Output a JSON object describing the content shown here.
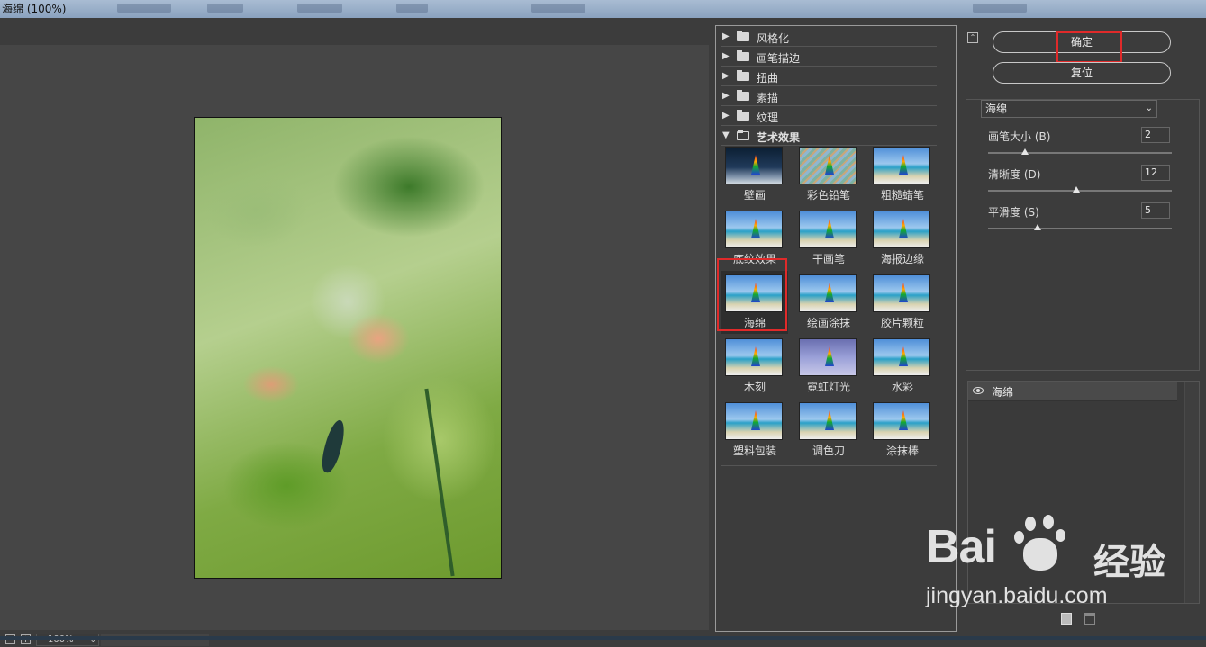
{
  "window": {
    "title": "海绵 (100%)"
  },
  "preview": {
    "zoom_value": "100%"
  },
  "filter_gallery": {
    "categories": [
      {
        "label": "风格化",
        "expanded": false
      },
      {
        "label": "画笔描边",
        "expanded": false
      },
      {
        "label": "扭曲",
        "expanded": false
      },
      {
        "label": "素描",
        "expanded": false
      },
      {
        "label": "纹理",
        "expanded": false
      },
      {
        "label": "艺术效果",
        "expanded": true
      }
    ],
    "thumbnails": [
      {
        "label": "壁画"
      },
      {
        "label": "彩色铅笔"
      },
      {
        "label": "粗糙蜡笔"
      },
      {
        "label": "底纹效果"
      },
      {
        "label": "干画笔"
      },
      {
        "label": "海报边缘"
      },
      {
        "label": "海绵",
        "selected": true
      },
      {
        "label": "绘画涂抹"
      },
      {
        "label": "胶片颗粒"
      },
      {
        "label": "木刻"
      },
      {
        "label": "霓虹灯光"
      },
      {
        "label": "水彩"
      },
      {
        "label": "塑料包装"
      },
      {
        "label": "调色刀"
      },
      {
        "label": "涂抹棒"
      }
    ]
  },
  "actions": {
    "ok_label": "确定",
    "reset_label": "复位"
  },
  "settings": {
    "filter_select": "海绵",
    "params": [
      {
        "label": "画笔大小 (B)",
        "value": "2",
        "level": 0.2
      },
      {
        "label": "清晰度 (D)",
        "value": "12",
        "level": 0.48
      },
      {
        "label": "平滑度 (S)",
        "value": "5",
        "level": 0.27
      }
    ]
  },
  "layers": {
    "items": [
      {
        "label": "海绵"
      }
    ]
  },
  "watermark": {
    "logo": "Bai du 经验",
    "url": "jingyan.baidu.com"
  },
  "colors": {
    "highlight": "#e02a2a",
    "panel": "#3c3c3c"
  }
}
